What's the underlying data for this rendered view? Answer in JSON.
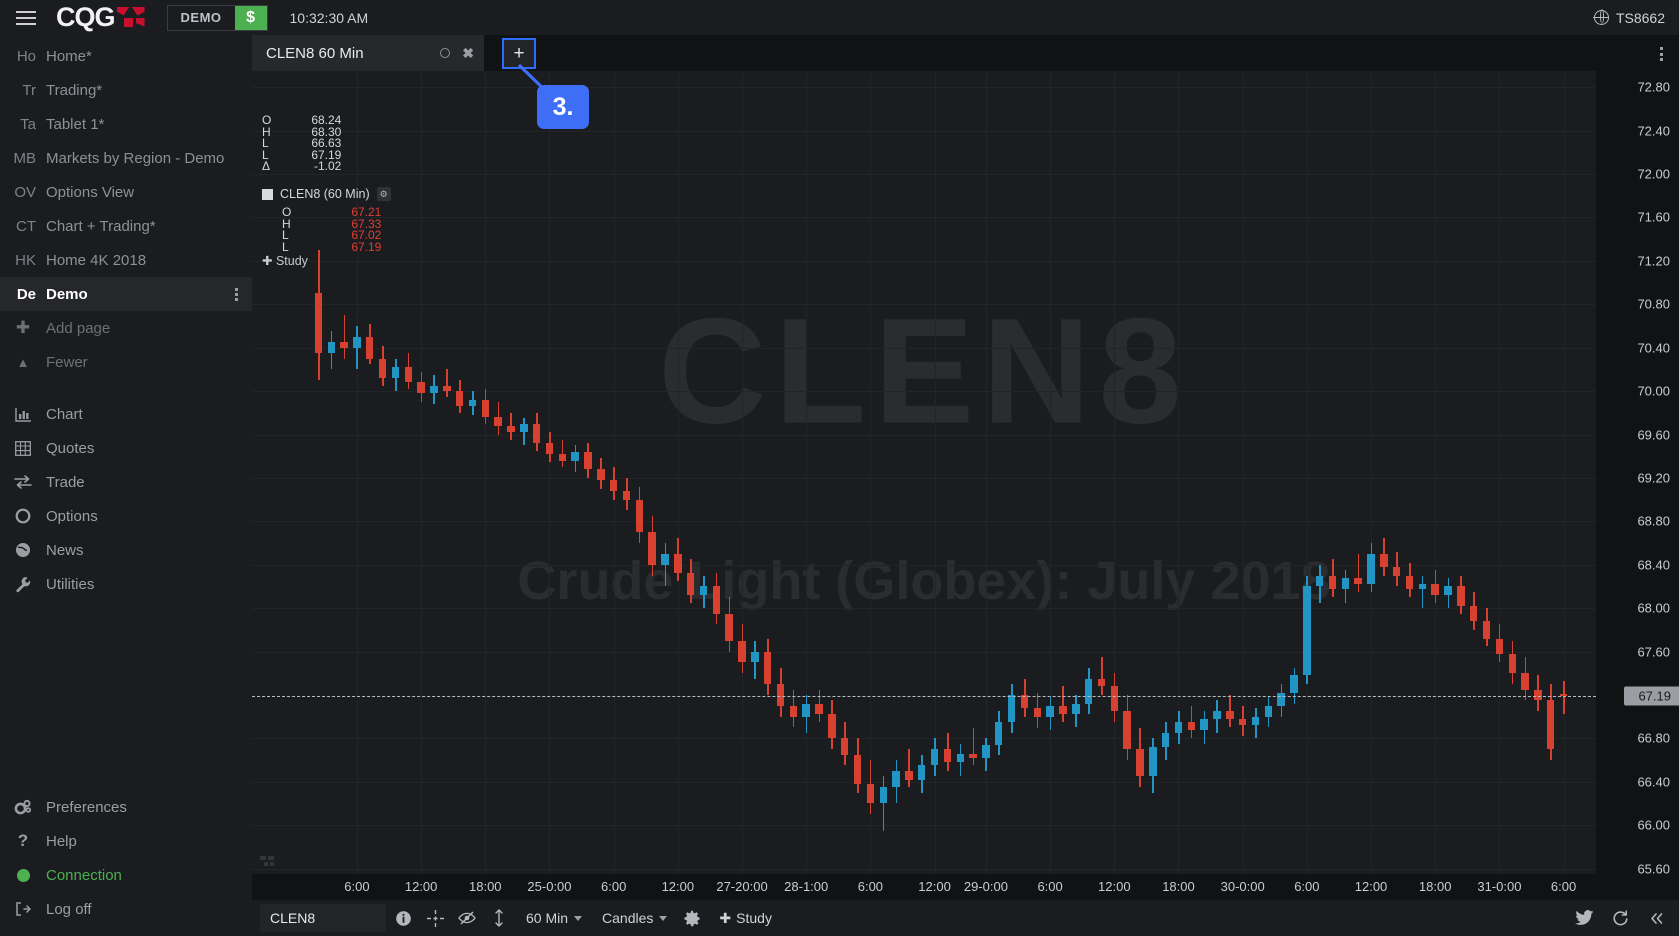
{
  "topbar": {
    "menu_icon": "hamburger-icon",
    "brand": "CQG",
    "demo_label": "DEMO",
    "currency_label": "$",
    "clock": "10:32:30 AM",
    "user_id": "TS8662"
  },
  "sidebar": {
    "pages": [
      {
        "abbr": "Ho",
        "label": "Home*"
      },
      {
        "abbr": "Tr",
        "label": "Trading*"
      },
      {
        "abbr": "Ta",
        "label": "Tablet 1*"
      },
      {
        "abbr": "MB",
        "label": "Markets by Region - Demo"
      },
      {
        "abbr": "OV",
        "label": "Options View"
      },
      {
        "abbr": "CT",
        "label": "Chart + Trading*"
      },
      {
        "abbr": "HK",
        "label": "Home 4K 2018"
      },
      {
        "abbr": "De",
        "label": "Demo",
        "active": true
      }
    ],
    "add_page": "Add page",
    "fewer": "Fewer",
    "tools": [
      {
        "icon": "chart-icon",
        "label": "Chart"
      },
      {
        "icon": "quotes-icon",
        "label": "Quotes"
      },
      {
        "icon": "trade-icon",
        "label": "Trade"
      },
      {
        "icon": "options-icon",
        "label": "Options"
      },
      {
        "icon": "news-icon",
        "label": "News"
      },
      {
        "icon": "utilities-icon",
        "label": "Utilities"
      }
    ],
    "footer": [
      {
        "icon": "preferences-icon",
        "label": "Preferences"
      },
      {
        "icon": "help-icon",
        "label": "Help"
      },
      {
        "icon": "connection-icon",
        "label": "Connection",
        "status": "connected"
      },
      {
        "icon": "logoff-icon",
        "label": "Log off"
      }
    ]
  },
  "tabbar": {
    "tab_title": "CLEN8 60 Min",
    "add_tab_label": "+",
    "callout_step": "3."
  },
  "chart_header": {
    "rows": [
      {
        "label": "O",
        "value": "68.24"
      },
      {
        "label": "H",
        "value": "68.30"
      },
      {
        "label": "L",
        "value": "66.63"
      },
      {
        "label": "L",
        "value": "67.19"
      },
      {
        "label": "Δ",
        "value": "-1.02"
      }
    ]
  },
  "chart_legend": {
    "name": "CLEN8 (60 Min)",
    "rows": [
      {
        "label": "O",
        "value": "67.21"
      },
      {
        "label": "H",
        "value": "67.33"
      },
      {
        "label": "L",
        "value": "67.02"
      },
      {
        "label": "L",
        "value": "67.19"
      }
    ],
    "study_label": "Study"
  },
  "watermark": {
    "symbol": "CLEN8",
    "description": "Crude Light (Globex): July 2018"
  },
  "bottom_toolbar": {
    "symbol": "CLEN8",
    "interval": "60 Min",
    "chart_type": "Candles",
    "study_label": "Study",
    "icons": [
      "info-icon",
      "crosshair-icon",
      "eye-slash-icon",
      "vertical-scale-icon",
      "gear-icon"
    ],
    "right_icons": [
      "twitter-icon",
      "reset-icon",
      "collapse-icon"
    ]
  },
  "chart_data": {
    "type": "candlestick",
    "title": "CLEN8 60 Min",
    "instrument": "Crude Light (Globex): July 2018",
    "interval": "60 Min",
    "xlabel": "",
    "ylabel": "",
    "ylim": [
      65.55,
      72.95
    ],
    "y_ticks": [
      "72.80",
      "72.40",
      "72.00",
      "71.60",
      "71.20",
      "70.80",
      "70.40",
      "70.00",
      "69.60",
      "69.20",
      "68.80",
      "68.40",
      "68.00",
      "67.60",
      "67.19",
      "66.80",
      "66.40",
      "66.00",
      "65.60"
    ],
    "y_tick_values": [
      72.8,
      72.4,
      72.0,
      71.6,
      71.2,
      70.8,
      70.4,
      70.0,
      69.6,
      69.2,
      68.8,
      68.4,
      68.0,
      67.6,
      66.8,
      66.4,
      66.0,
      65.6
    ],
    "x_ticks": [
      "6:00",
      "12:00",
      "18:00",
      "25-0:00",
      "6:00",
      "12:00",
      "27-20:00",
      "28-1:00",
      "6:00",
      "12:00",
      "29-0:00",
      "6:00",
      "12:00",
      "18:00",
      "30-0:00",
      "6:00",
      "12:00",
      "18:00",
      "31-0:00",
      "6:00"
    ],
    "last_price": 67.19,
    "last_price_label": "67.19",
    "session_open": 68.24,
    "session_high": 68.3,
    "session_low": 66.63,
    "session_close": 67.19,
    "session_change": -1.02,
    "bar_open": 67.21,
    "bar_high": 67.33,
    "bar_low": 67.02,
    "bar_close": 67.19,
    "up_color": "#2196c4",
    "down_color": "#d8412f",
    "grid": true,
    "legend": "none",
    "candles": [
      {
        "o": 70.9,
        "h": 71.3,
        "l": 70.1,
        "c": 70.35,
        "d": 1
      },
      {
        "o": 70.35,
        "h": 70.55,
        "l": 70.2,
        "c": 70.45,
        "d": 0
      },
      {
        "o": 70.45,
        "h": 70.7,
        "l": 70.3,
        "c": 70.4,
        "d": 1
      },
      {
        "o": 70.4,
        "h": 70.6,
        "l": 70.2,
        "c": 70.5,
        "d": 0
      },
      {
        "o": 70.5,
        "h": 70.62,
        "l": 70.25,
        "c": 70.3,
        "d": 1
      },
      {
        "o": 70.3,
        "h": 70.42,
        "l": 70.05,
        "c": 70.12,
        "d": 1
      },
      {
        "o": 70.12,
        "h": 70.3,
        "l": 70.0,
        "c": 70.22,
        "d": 0
      },
      {
        "o": 70.22,
        "h": 70.35,
        "l": 70.02,
        "c": 70.08,
        "d": 1
      },
      {
        "o": 70.08,
        "h": 70.18,
        "l": 69.9,
        "c": 69.98,
        "d": 1
      },
      {
        "o": 69.98,
        "h": 70.15,
        "l": 69.88,
        "c": 70.05,
        "d": 0
      },
      {
        "o": 70.05,
        "h": 70.2,
        "l": 69.95,
        "c": 70.0,
        "d": 1
      },
      {
        "o": 70.0,
        "h": 70.1,
        "l": 69.8,
        "c": 69.86,
        "d": 1
      },
      {
        "o": 69.86,
        "h": 70.0,
        "l": 69.78,
        "c": 69.92,
        "d": 0
      },
      {
        "o": 69.92,
        "h": 70.02,
        "l": 69.7,
        "c": 69.76,
        "d": 1
      },
      {
        "o": 69.76,
        "h": 69.9,
        "l": 69.6,
        "c": 69.68,
        "d": 1
      },
      {
        "o": 69.68,
        "h": 69.8,
        "l": 69.55,
        "c": 69.62,
        "d": 1
      },
      {
        "o": 69.62,
        "h": 69.75,
        "l": 69.5,
        "c": 69.7,
        "d": 0
      },
      {
        "o": 69.7,
        "h": 69.8,
        "l": 69.45,
        "c": 69.52,
        "d": 1
      },
      {
        "o": 69.52,
        "h": 69.62,
        "l": 69.35,
        "c": 69.42,
        "d": 1
      },
      {
        "o": 69.42,
        "h": 69.55,
        "l": 69.3,
        "c": 69.36,
        "d": 1
      },
      {
        "o": 69.36,
        "h": 69.5,
        "l": 69.25,
        "c": 69.44,
        "d": 0
      },
      {
        "o": 69.44,
        "h": 69.52,
        "l": 69.2,
        "c": 69.28,
        "d": 1
      },
      {
        "o": 69.28,
        "h": 69.38,
        "l": 69.1,
        "c": 69.18,
        "d": 1
      },
      {
        "o": 69.18,
        "h": 69.3,
        "l": 69.0,
        "c": 69.08,
        "d": 1
      },
      {
        "o": 69.08,
        "h": 69.2,
        "l": 68.9,
        "c": 69.0,
        "d": 1
      },
      {
        "o": 69.0,
        "h": 69.12,
        "l": 68.6,
        "c": 68.7,
        "d": 1
      },
      {
        "o": 68.7,
        "h": 68.85,
        "l": 68.3,
        "c": 68.4,
        "d": 1
      },
      {
        "o": 68.4,
        "h": 68.6,
        "l": 68.2,
        "c": 68.5,
        "d": 0
      },
      {
        "o": 68.5,
        "h": 68.65,
        "l": 68.25,
        "c": 68.32,
        "d": 1
      },
      {
        "o": 68.32,
        "h": 68.45,
        "l": 68.05,
        "c": 68.12,
        "d": 1
      },
      {
        "o": 68.12,
        "h": 68.3,
        "l": 68.0,
        "c": 68.2,
        "d": 0
      },
      {
        "o": 68.2,
        "h": 68.32,
        "l": 67.85,
        "c": 67.95,
        "d": 1
      },
      {
        "o": 67.95,
        "h": 68.1,
        "l": 67.6,
        "c": 67.7,
        "d": 1
      },
      {
        "o": 67.7,
        "h": 67.85,
        "l": 67.4,
        "c": 67.5,
        "d": 1
      },
      {
        "o": 67.5,
        "h": 67.7,
        "l": 67.35,
        "c": 67.6,
        "d": 0
      },
      {
        "o": 67.6,
        "h": 67.72,
        "l": 67.2,
        "c": 67.3,
        "d": 1
      },
      {
        "o": 67.3,
        "h": 67.45,
        "l": 67.0,
        "c": 67.1,
        "d": 1
      },
      {
        "o": 67.1,
        "h": 67.25,
        "l": 66.9,
        "c": 67.0,
        "d": 1
      },
      {
        "o": 67.0,
        "h": 67.2,
        "l": 66.85,
        "c": 67.12,
        "d": 0
      },
      {
        "o": 67.12,
        "h": 67.25,
        "l": 66.95,
        "c": 67.02,
        "d": 1
      },
      {
        "o": 67.02,
        "h": 67.15,
        "l": 66.7,
        "c": 66.8,
        "d": 1
      },
      {
        "o": 66.8,
        "h": 66.95,
        "l": 66.55,
        "c": 66.65,
        "d": 1
      },
      {
        "o": 66.65,
        "h": 66.8,
        "l": 66.3,
        "c": 66.38,
        "d": 1
      },
      {
        "o": 66.38,
        "h": 66.6,
        "l": 66.1,
        "c": 66.2,
        "d": 1
      },
      {
        "o": 66.2,
        "h": 66.45,
        "l": 65.95,
        "c": 66.35,
        "d": 0
      },
      {
        "o": 66.35,
        "h": 66.6,
        "l": 66.2,
        "c": 66.5,
        "d": 0
      },
      {
        "o": 66.5,
        "h": 66.7,
        "l": 66.35,
        "c": 66.42,
        "d": 1
      },
      {
        "o": 66.42,
        "h": 66.65,
        "l": 66.3,
        "c": 66.55,
        "d": 0
      },
      {
        "o": 66.55,
        "h": 66.8,
        "l": 66.45,
        "c": 66.7,
        "d": 0
      },
      {
        "o": 66.7,
        "h": 66.85,
        "l": 66.5,
        "c": 66.58,
        "d": 1
      },
      {
        "o": 66.58,
        "h": 66.75,
        "l": 66.45,
        "c": 66.66,
        "d": 0
      },
      {
        "o": 66.66,
        "h": 66.9,
        "l": 66.55,
        "c": 66.62,
        "d": 1
      },
      {
        "o": 66.62,
        "h": 66.8,
        "l": 66.5,
        "c": 66.74,
        "d": 0
      },
      {
        "o": 66.74,
        "h": 67.05,
        "l": 66.65,
        "c": 66.95,
        "d": 0
      },
      {
        "o": 66.95,
        "h": 67.3,
        "l": 66.85,
        "c": 67.2,
        "d": 0
      },
      {
        "o": 67.2,
        "h": 67.35,
        "l": 67.0,
        "c": 67.08,
        "d": 1
      },
      {
        "o": 67.08,
        "h": 67.22,
        "l": 66.9,
        "c": 67.0,
        "d": 1
      },
      {
        "o": 67.0,
        "h": 67.18,
        "l": 66.88,
        "c": 67.1,
        "d": 0
      },
      {
        "o": 67.1,
        "h": 67.28,
        "l": 66.95,
        "c": 67.02,
        "d": 1
      },
      {
        "o": 67.02,
        "h": 67.2,
        "l": 66.9,
        "c": 67.12,
        "d": 0
      },
      {
        "o": 67.12,
        "h": 67.45,
        "l": 67.02,
        "c": 67.35,
        "d": 0
      },
      {
        "o": 67.35,
        "h": 67.55,
        "l": 67.2,
        "c": 67.28,
        "d": 1
      },
      {
        "o": 67.28,
        "h": 67.4,
        "l": 66.95,
        "c": 67.05,
        "d": 1
      },
      {
        "o": 67.05,
        "h": 67.2,
        "l": 66.6,
        "c": 66.7,
        "d": 1
      },
      {
        "o": 66.7,
        "h": 66.9,
        "l": 66.35,
        "c": 66.45,
        "d": 1
      },
      {
        "o": 66.45,
        "h": 66.8,
        "l": 66.3,
        "c": 66.72,
        "d": 0
      },
      {
        "o": 66.72,
        "h": 66.95,
        "l": 66.6,
        "c": 66.85,
        "d": 0
      },
      {
        "o": 66.85,
        "h": 67.05,
        "l": 66.75,
        "c": 66.95,
        "d": 0
      },
      {
        "o": 66.95,
        "h": 67.1,
        "l": 66.8,
        "c": 66.88,
        "d": 1
      },
      {
        "o": 66.88,
        "h": 67.05,
        "l": 66.75,
        "c": 66.98,
        "d": 0
      },
      {
        "o": 66.98,
        "h": 67.15,
        "l": 66.85,
        "c": 67.05,
        "d": 0
      },
      {
        "o": 67.05,
        "h": 67.2,
        "l": 66.9,
        "c": 66.98,
        "d": 1
      },
      {
        "o": 66.98,
        "h": 67.1,
        "l": 66.82,
        "c": 66.92,
        "d": 1
      },
      {
        "o": 66.92,
        "h": 67.08,
        "l": 66.8,
        "c": 67.0,
        "d": 0
      },
      {
        "o": 67.0,
        "h": 67.18,
        "l": 66.9,
        "c": 67.1,
        "d": 0
      },
      {
        "o": 67.1,
        "h": 67.3,
        "l": 67.0,
        "c": 67.22,
        "d": 0
      },
      {
        "o": 67.22,
        "h": 67.45,
        "l": 67.12,
        "c": 67.38,
        "d": 0
      },
      {
        "o": 67.38,
        "h": 68.3,
        "l": 67.3,
        "c": 68.2,
        "d": 0
      },
      {
        "o": 68.2,
        "h": 68.4,
        "l": 68.05,
        "c": 68.3,
        "d": 0
      },
      {
        "o": 68.3,
        "h": 68.45,
        "l": 68.1,
        "c": 68.18,
        "d": 1
      },
      {
        "o": 68.18,
        "h": 68.35,
        "l": 68.05,
        "c": 68.28,
        "d": 0
      },
      {
        "o": 68.28,
        "h": 68.5,
        "l": 68.15,
        "c": 68.22,
        "d": 1
      },
      {
        "o": 68.22,
        "h": 68.6,
        "l": 68.15,
        "c": 68.5,
        "d": 0
      },
      {
        "o": 68.5,
        "h": 68.65,
        "l": 68.3,
        "c": 68.38,
        "d": 1
      },
      {
        "o": 68.38,
        "h": 68.52,
        "l": 68.2,
        "c": 68.3,
        "d": 1
      },
      {
        "o": 68.3,
        "h": 68.42,
        "l": 68.1,
        "c": 68.18,
        "d": 1
      },
      {
        "o": 68.18,
        "h": 68.3,
        "l": 68.0,
        "c": 68.22,
        "d": 0
      },
      {
        "o": 68.22,
        "h": 68.35,
        "l": 68.05,
        "c": 68.12,
        "d": 1
      },
      {
        "o": 68.12,
        "h": 68.28,
        "l": 68.0,
        "c": 68.2,
        "d": 0
      },
      {
        "o": 68.2,
        "h": 68.3,
        "l": 67.95,
        "c": 68.02,
        "d": 1
      },
      {
        "o": 68.02,
        "h": 68.15,
        "l": 67.8,
        "c": 67.88,
        "d": 1
      },
      {
        "o": 67.88,
        "h": 68.0,
        "l": 67.65,
        "c": 67.72,
        "d": 1
      },
      {
        "o": 67.72,
        "h": 67.85,
        "l": 67.5,
        "c": 67.58,
        "d": 1
      },
      {
        "o": 67.58,
        "h": 67.7,
        "l": 67.3,
        "c": 67.4,
        "d": 1
      },
      {
        "o": 67.4,
        "h": 67.55,
        "l": 67.15,
        "c": 67.25,
        "d": 1
      },
      {
        "o": 67.25,
        "h": 67.38,
        "l": 67.05,
        "c": 67.15,
        "d": 1
      },
      {
        "o": 67.15,
        "h": 67.3,
        "l": 66.6,
        "c": 66.7,
        "d": 1
      },
      {
        "o": 67.21,
        "h": 67.33,
        "l": 67.02,
        "c": 67.19,
        "d": 1
      }
    ]
  }
}
